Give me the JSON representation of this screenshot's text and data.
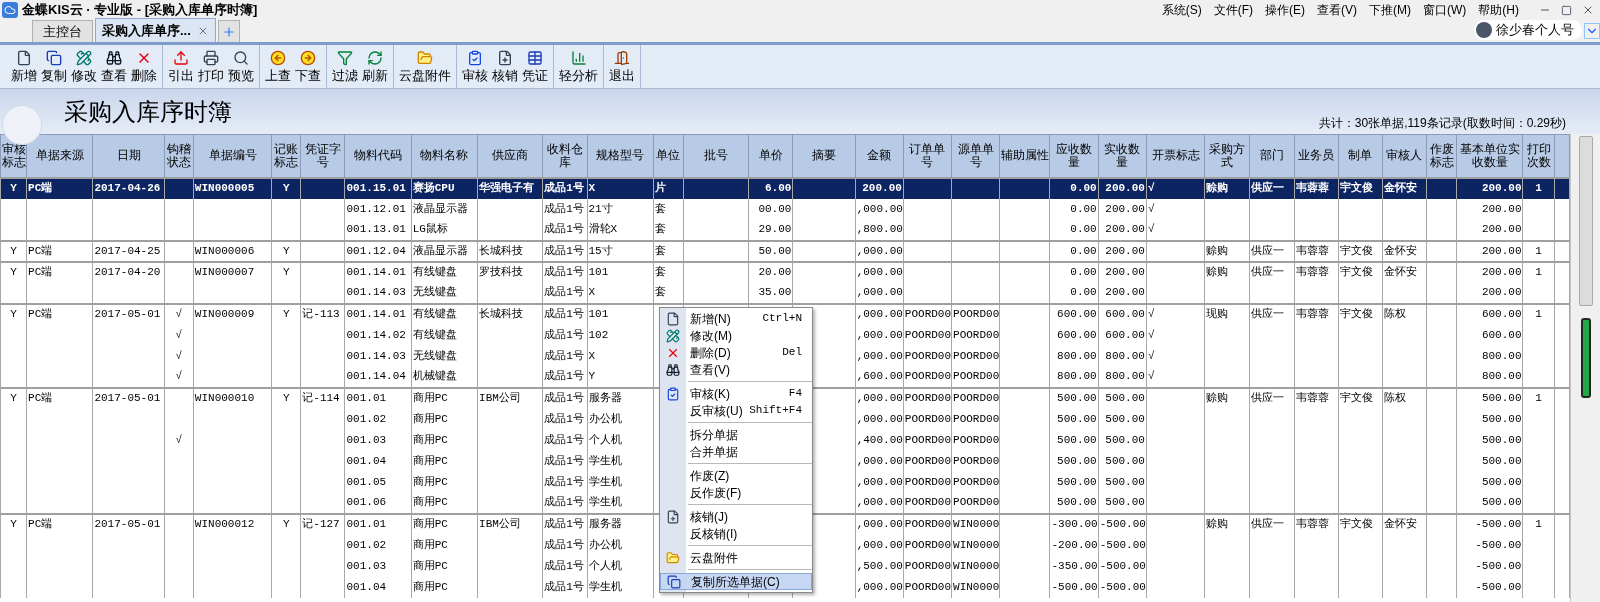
{
  "window": {
    "title": "金蝶KIS云 · 专业版 - [采购入库单序时簿]"
  },
  "menu_bar": [
    "系统(S)",
    "文件(F)",
    "操作(E)",
    "查看(V)",
    "下推(M)",
    "窗口(W)",
    "帮助(H)"
  ],
  "tabs": [
    {
      "label": "主控台",
      "selected": false
    },
    {
      "label": "采购入库单序...",
      "selected": true,
      "closable": true
    }
  ],
  "user": {
    "name": "徐少春个人号"
  },
  "toolbar": [
    [
      "新增",
      "复制",
      "修改",
      "查看",
      "删除"
    ],
    [
      "引出",
      "打印",
      "预览"
    ],
    [
      "上查",
      "下查"
    ],
    [
      "过滤",
      "刷新"
    ],
    [
      "云盘附件"
    ],
    [
      "审核",
      "核销",
      "凭证"
    ],
    [
      "轻分析"
    ],
    [
      "退出"
    ]
  ],
  "report": {
    "title": "采购入库序时簿",
    "summary": "共计：30张单据,119条记录(取数时间：0.29秒)"
  },
  "table": {
    "columns": [
      "审核标志",
      "单据来源",
      "日期",
      "钩稽状态",
      "单据编号",
      "记账标志",
      "凭证字号",
      "物料代码",
      "物料名称",
      "供应商",
      "收料仓库",
      "规格型号",
      "单位",
      "批号",
      "单价",
      "摘要",
      "金额",
      "订单单号",
      "源单单号",
      "辅助属性",
      "应收数量",
      "实收数量",
      "开票标志",
      "采购方式",
      "部门",
      "业务员",
      "制单",
      "审核人",
      "作废标志",
      "基本单位实收数量",
      "打印次数"
    ],
    "documents": [
      {
        "rows": [
          {
            "selected": true,
            "cells": [
              "Y",
              "PC端",
              "2017-04-26",
              null,
              "WIN000005",
              "Y",
              null,
              "001.15.01",
              "赛扬CPU",
              "华强电子有",
              "成品1号",
              "X",
              "片",
              null,
              "6.00",
              null,
              "200.00",
              null,
              null,
              null,
              "0.00",
              "200.00",
              "√",
              "赊购",
              "供应一",
              "韦蓉蓉",
              "宇文俊",
              "金怀安",
              null,
              "200.00",
              "1"
            ]
          },
          {
            "selected": false,
            "cells": [
              null,
              null,
              null,
              null,
              null,
              null,
              null,
              "001.12.01",
              "液晶显示器",
              null,
              "成品1号",
              "21寸",
              "套",
              null,
              "00.00",
              null,
              ",000.00",
              null,
              null,
              null,
              "0.00",
              "200.00",
              "√",
              null,
              null,
              null,
              null,
              null,
              null,
              "200.00",
              null
            ]
          },
          {
            "selected": false,
            "cells": [
              null,
              null,
              null,
              null,
              null,
              null,
              null,
              "001.13.01",
              "LG鼠标",
              null,
              "成品1号",
              "滑轮X",
              "套",
              null,
              "29.00",
              null,
              ",800.00",
              null,
              null,
              null,
              "0.00",
              "200.00",
              "√",
              null,
              null,
              null,
              null,
              null,
              null,
              "200.00",
              null
            ]
          }
        ]
      },
      {
        "rows": [
          {
            "selected": false,
            "cells": [
              "Y",
              "PC端",
              "2017-04-25",
              null,
              "WIN000006",
              "Y",
              null,
              "001.12.04",
              "液晶显示器",
              "长城科技",
              "成品1号",
              "15寸",
              "套",
              null,
              "50.00",
              null,
              ",000.00",
              null,
              null,
              null,
              "0.00",
              "200.00",
              null,
              "赊购",
              "供应一",
              "韦蓉蓉",
              "宇文俊",
              "金怀安",
              null,
              "200.00",
              "1"
            ]
          }
        ]
      },
      {
        "rows": [
          {
            "selected": false,
            "cells": [
              "Y",
              "PC端",
              "2017-04-20",
              null,
              "WIN000007",
              "Y",
              null,
              "001.14.01",
              "有线键盘",
              "罗技科技",
              "成品1号",
              "101",
              "套",
              null,
              "20.00",
              null,
              ",000.00",
              null,
              null,
              null,
              "0.00",
              "200.00",
              null,
              "赊购",
              "供应一",
              "韦蓉蓉",
              "宇文俊",
              "金怀安",
              null,
              "200.00",
              "1"
            ]
          },
          {
            "selected": false,
            "cells": [
              null,
              null,
              null,
              null,
              null,
              null,
              null,
              "001.14.03",
              "无线键盘",
              null,
              "成品1号",
              "X",
              "套",
              null,
              "35.00",
              null,
              ",000.00",
              null,
              null,
              null,
              "0.00",
              "200.00",
              null,
              null,
              null,
              null,
              null,
              null,
              null,
              "200.00",
              null
            ]
          }
        ]
      },
      {
        "rows": [
          {
            "selected": false,
            "cells": [
              "Y",
              "PC端",
              "2017-05-01",
              "√",
              "WIN000009",
              "Y",
              "记-113",
              "001.14.01",
              "有线键盘",
              "长城科技",
              "成品1号",
              "101",
              null,
              null,
              null,
              null,
              ",000.00",
              "POORD00",
              "POORD00",
              null,
              "600.00",
              "600.00",
              "√",
              "现购",
              "供应一",
              "韦蓉蓉",
              "宇文俊",
              "陈权",
              null,
              "600.00",
              "1"
            ]
          },
          {
            "selected": false,
            "cells": [
              null,
              null,
              null,
              "√",
              null,
              null,
              null,
              "001.14.02",
              "有线键盘",
              null,
              "成品1号",
              "102",
              null,
              null,
              null,
              null,
              ",000.00",
              "POORD00",
              "POORD00",
              null,
              "600.00",
              "600.00",
              "√",
              null,
              null,
              null,
              null,
              null,
              null,
              "600.00",
              null
            ]
          },
          {
            "selected": false,
            "cells": [
              null,
              null,
              null,
              "√",
              null,
              null,
              null,
              "001.14.03",
              "无线键盘",
              null,
              "成品1号",
              "X",
              null,
              null,
              null,
              null,
              ",000.00",
              "POORD00",
              "POORD00",
              null,
              "800.00",
              "800.00",
              "√",
              null,
              null,
              null,
              null,
              null,
              null,
              "800.00",
              null
            ]
          },
          {
            "selected": false,
            "cells": [
              null,
              null,
              null,
              "√",
              null,
              null,
              null,
              "001.14.04",
              "机械键盘",
              null,
              "成品1号",
              "Y",
              null,
              null,
              null,
              null,
              ",600.00",
              "POORD00",
              "POORD00",
              null,
              "800.00",
              "800.00",
              "√",
              null,
              null,
              null,
              null,
              null,
              null,
              "800.00",
              null
            ]
          }
        ]
      },
      {
        "rows": [
          {
            "selected": false,
            "cells": [
              "Y",
              "PC端",
              "2017-05-01",
              null,
              "WIN000010",
              "Y",
              "记-114",
              "001.01",
              "商用PC",
              "IBM公司",
              "成品1号",
              "服务器",
              null,
              null,
              null,
              null,
              ",000.00",
              "POORD00",
              "POORD00",
              null,
              "500.00",
              "500.00",
              null,
              "赊购",
              "供应一",
              "韦蓉蓉",
              "宇文俊",
              "陈权",
              null,
              "500.00",
              "1"
            ]
          },
          {
            "selected": false,
            "cells": [
              null,
              null,
              null,
              null,
              null,
              null,
              null,
              "001.02",
              "商用PC",
              null,
              "成品1号",
              "办公机",
              null,
              null,
              null,
              null,
              ",000.00",
              "POORD00",
              "POORD00",
              null,
              "500.00",
              "500.00",
              null,
              null,
              null,
              null,
              null,
              null,
              null,
              "500.00",
              null
            ]
          },
          {
            "selected": false,
            "cells": [
              null,
              null,
              null,
              "√",
              null,
              null,
              null,
              "001.03",
              "商用PC",
              null,
              "成品1号",
              "个人机",
              null,
              null,
              null,
              null,
              ",400.00",
              "POORD00",
              "POORD00",
              null,
              "500.00",
              "500.00",
              null,
              null,
              null,
              null,
              null,
              null,
              null,
              "500.00",
              null
            ]
          },
          {
            "selected": false,
            "cells": [
              null,
              null,
              null,
              null,
              null,
              null,
              null,
              "001.04",
              "商用PC",
              null,
              "成品1号",
              "学生机",
              null,
              null,
              null,
              null,
              ",000.00",
              "POORD00",
              "POORD00",
              null,
              "500.00",
              "500.00",
              null,
              null,
              null,
              null,
              null,
              null,
              null,
              "500.00",
              null
            ]
          },
          {
            "selected": false,
            "cells": [
              null,
              null,
              null,
              null,
              null,
              null,
              null,
              "001.05",
              "商用PC",
              null,
              "成品1号",
              "学生机",
              null,
              null,
              null,
              null,
              ",000.00",
              "POORD00",
              "POORD00",
              null,
              "500.00",
              "500.00",
              null,
              null,
              null,
              null,
              null,
              null,
              null,
              "500.00",
              null
            ]
          },
          {
            "selected": false,
            "cells": [
              null,
              null,
              null,
              null,
              null,
              null,
              null,
              "001.06",
              "商用PC",
              null,
              "成品1号",
              "学生机",
              null,
              null,
              null,
              null,
              ",000.00",
              "POORD00",
              "POORD00",
              null,
              "500.00",
              "500.00",
              null,
              null,
              null,
              null,
              null,
              null,
              null,
              "500.00",
              null
            ]
          }
        ]
      },
      {
        "rows": [
          {
            "selected": false,
            "cells": [
              "Y",
              "PC端",
              "2017-05-01",
              null,
              "WIN000012",
              "Y",
              "记-127",
              "001.01",
              "商用PC",
              "IBM公司",
              "成品1号",
              "服务器",
              null,
              null,
              null,
              null,
              ",000.00",
              "POORD00",
              "WIN0000",
              null,
              "-300.00",
              "-500.00",
              null,
              "赊购",
              "供应一",
              "韦蓉蓉",
              "宇文俊",
              "金怀安",
              null,
              "-500.00",
              "1"
            ]
          },
          {
            "selected": false,
            "cells": [
              null,
              null,
              null,
              null,
              null,
              null,
              null,
              "001.02",
              "商用PC",
              null,
              "成品1号",
              "办公机",
              null,
              null,
              null,
              null,
              ",000.00",
              "POORD00",
              "WIN0000",
              null,
              "-200.00",
              "-500.00",
              null,
              null,
              null,
              null,
              null,
              null,
              null,
              "-500.00",
              null
            ]
          },
          {
            "selected": false,
            "cells": [
              null,
              null,
              null,
              null,
              null,
              null,
              null,
              "001.03",
              "商用PC",
              null,
              "成品1号",
              "个人机",
              null,
              null,
              null,
              null,
              ",500.00",
              "POORD00",
              "WIN0000",
              null,
              "-350.00",
              "-500.00",
              null,
              null,
              null,
              null,
              null,
              null,
              null,
              "-500.00",
              null
            ]
          },
          {
            "selected": false,
            "cells": [
              null,
              null,
              null,
              null,
              null,
              null,
              null,
              "001.04",
              "商用PC",
              null,
              "成品1号",
              "学生机",
              null,
              null,
              null,
              null,
              ",000.00",
              "POORD00",
              "WIN0000",
              null,
              "-500.00",
              "-500.00",
              null,
              null,
              null,
              null,
              null,
              null,
              null,
              "-500.00",
              null
            ]
          }
        ]
      }
    ]
  },
  "context_menu": [
    {
      "kind": "item",
      "label": "新增(N)",
      "shortcut": "Ctrl+N",
      "highlighted": false
    },
    {
      "kind": "item",
      "label": "修改(M)",
      "highlighted": false
    },
    {
      "kind": "item",
      "label": "删除(D)",
      "shortcut": "Del",
      "highlighted": false
    },
    {
      "kind": "item",
      "label": "查看(V)",
      "highlighted": false
    },
    {
      "kind": "separator"
    },
    {
      "kind": "item",
      "label": "审核(K)",
      "shortcut": "F4",
      "highlighted": false
    },
    {
      "kind": "item",
      "label": "反审核(U)",
      "shortcut": "Shift+F4",
      "highlighted": false
    },
    {
      "kind": "separator"
    },
    {
      "kind": "item",
      "label": "拆分单据",
      "highlighted": false
    },
    {
      "kind": "item",
      "label": "合并单据",
      "highlighted": false
    },
    {
      "kind": "separator"
    },
    {
      "kind": "item",
      "label": "作废(Z)",
      "highlighted": false
    },
    {
      "kind": "item",
      "label": "反作废(F)",
      "highlighted": false
    },
    {
      "kind": "separator"
    },
    {
      "kind": "item",
      "label": "核销(J)",
      "highlighted": false
    },
    {
      "kind": "item",
      "label": "反核销(I)",
      "highlighted": false
    },
    {
      "kind": "separator"
    },
    {
      "kind": "item",
      "label": "云盘附件",
      "highlighted": false
    },
    {
      "kind": "separator"
    },
    {
      "kind": "item",
      "label": "复制所选单据(C)",
      "highlighted": true
    }
  ]
}
